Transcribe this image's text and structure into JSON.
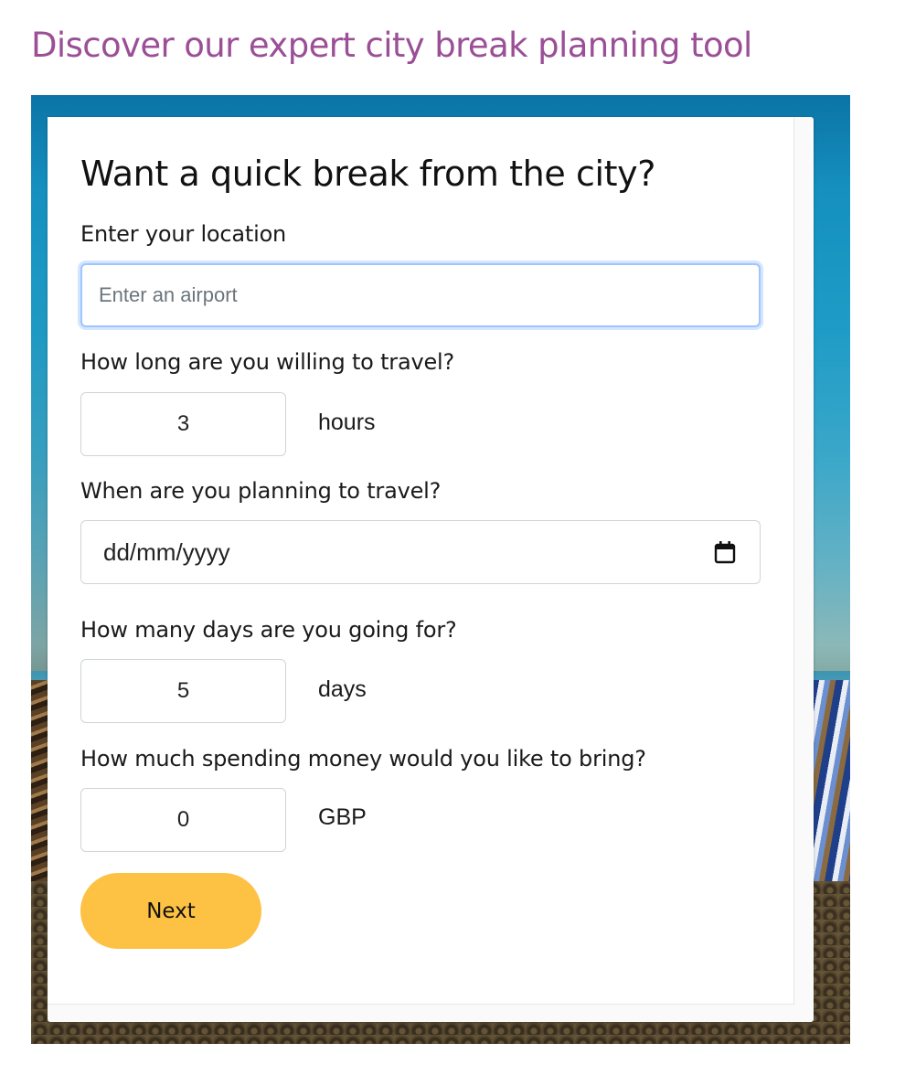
{
  "page": {
    "heading": "Discover our expert city break planning tool",
    "heading_color": "#9b4f96"
  },
  "form": {
    "title": "Want a quick break from the city?",
    "location": {
      "label": "Enter your location",
      "value": "",
      "placeholder": "Enter an airport"
    },
    "travel_time": {
      "label": "How long are you willing to travel?",
      "value": "3",
      "unit": "hours"
    },
    "travel_date": {
      "label": "When are you planning to travel?",
      "value": "dd/mm/yyyy",
      "icon": "calendar-icon"
    },
    "duration": {
      "label": "How many days are you going for?",
      "value": "5",
      "unit": "days"
    },
    "spending": {
      "label": "How much spending money would you like to bring?",
      "value": "0",
      "unit": "GBP"
    },
    "next_button": {
      "label": "Next",
      "color": "#fdc143"
    }
  }
}
